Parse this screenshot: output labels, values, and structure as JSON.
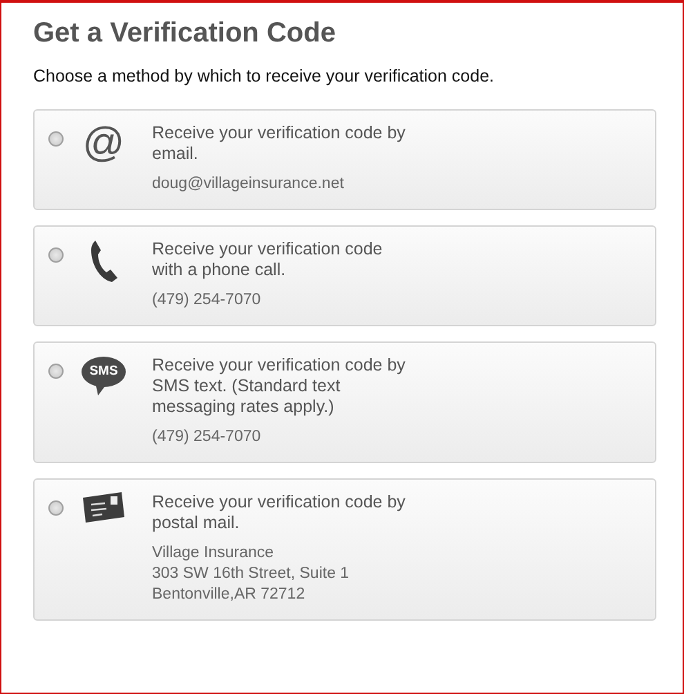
{
  "title": "Get a Verification Code",
  "subtitle": "Choose a method by which to receive your verification code.",
  "methods": [
    {
      "kind": "email",
      "selected": false,
      "icon_label": "@",
      "description": "Receive your verification code by\nemail.",
      "detail": "doug@villageinsurance.net"
    },
    {
      "kind": "phone",
      "selected": false,
      "description": "Receive your verification code\nwith a phone call.",
      "detail": "(479) 254-7070"
    },
    {
      "kind": "sms",
      "selected": false,
      "icon_label": "SMS",
      "description": "Receive your verification code by\nSMS text. (Standard text\nmessaging rates apply.)",
      "detail": "(479) 254-7070"
    },
    {
      "kind": "mail",
      "selected": false,
      "description": "Receive your verification code by\npostal mail.",
      "detail": "Village Insurance\n303 SW 16th Street, Suite 1\nBentonville,AR 72712"
    }
  ]
}
